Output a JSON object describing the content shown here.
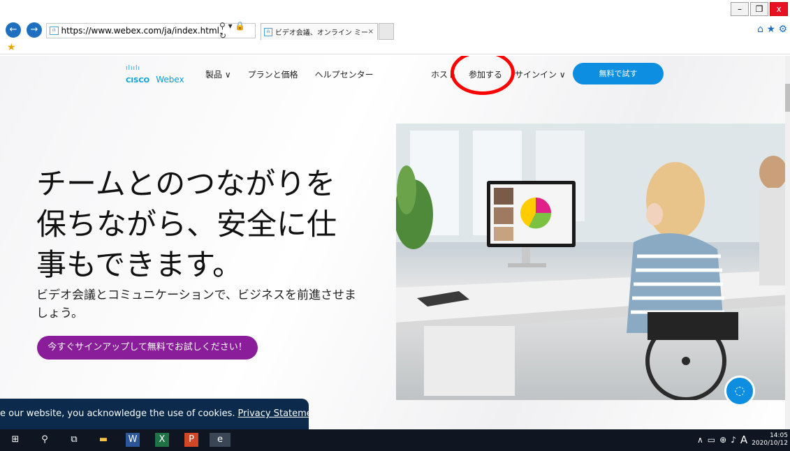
{
  "browser": {
    "url": "https://www.webex.com/ja/index.html",
    "tab_title": "ビデオ会議、オンライン ミーティ...",
    "tab_close": "×",
    "window_minimize": "–",
    "window_restore": "❐",
    "window_close": "x",
    "nav_back_icon": "←",
    "nav_forward_icon": "→",
    "address_icons": "⚲ ▾ 🔒 ↻",
    "tools": "⌂ ★ ⚙"
  },
  "header": {
    "logo_bars": "ılıılı",
    "logo_cisco": "CISCO",
    "logo_webex": "Webex",
    "nav_products": "製品 ∨",
    "nav_plans": "プランと価格",
    "nav_help": "ヘルプセンター",
    "nav_host": "ホスト",
    "nav_join": "参加する",
    "nav_signin": "サインイン ∨",
    "trial_button": "無料で試す"
  },
  "hero": {
    "line1": "チームとのつながりを",
    "line2": "保ちながら、安全に仕",
    "line3": "事もできます。",
    "subtitle": "ビデオ会議とコミュニケーションで、ビジネスを前進させましょう。",
    "cta": "今すぐサインアップして無料でお試しください！"
  },
  "cookie": {
    "text": "e our website, you acknowledge the use of cookies.",
    "link": "Privacy Statement"
  },
  "taskbar": {
    "clock_time": "14:05",
    "clock_date": "2020/10/12",
    "ime": "A"
  }
}
